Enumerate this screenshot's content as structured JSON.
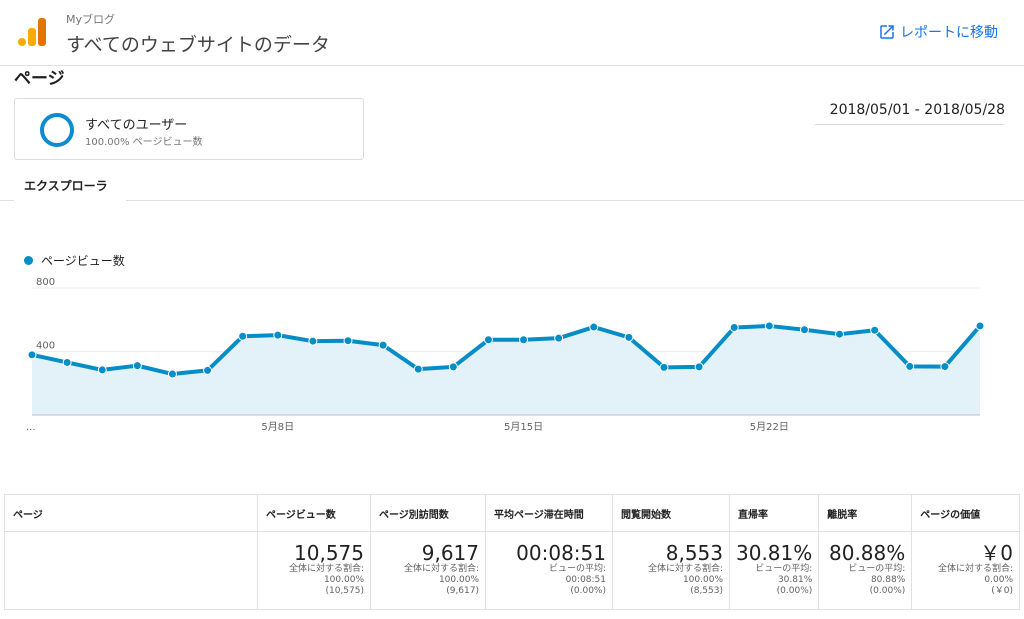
{
  "header": {
    "account": "Myブログ",
    "property": "すべてのウェブサイトのデータ",
    "report_link": "レポートに移動"
  },
  "page_title": "ページ",
  "segment": {
    "name": "すべてのユーザー",
    "sub": "100.00% ページビュー数"
  },
  "date_range": "2018/05/01 - 2018/05/28",
  "tab": "エクスプローラ",
  "legend": "ページビュー数",
  "colors": {
    "line": "#058dc7",
    "fill": "#e3f1f9",
    "link": "#1a73e8"
  },
  "chart_data": {
    "type": "line",
    "series": [
      {
        "name": "ページビュー数",
        "values": [
          379,
          331,
          284,
          311,
          258,
          281,
          496,
          503,
          465,
          468,
          440,
          289,
          303,
          474,
          474,
          484,
          554,
          489,
          300,
          303,
          551,
          561,
          537,
          509,
          534,
          306,
          305,
          561
        ]
      }
    ],
    "yticks": [
      {
        "value": 400,
        "label": "400"
      },
      {
        "value": 800,
        "label": "800"
      }
    ],
    "xticks": [
      {
        "index": 0,
        "label": "..."
      },
      {
        "index": 7,
        "label": "5月8日"
      },
      {
        "index": 14,
        "label": "5月15日"
      },
      {
        "index": 21,
        "label": "5月22日"
      }
    ],
    "ylim": [
      0,
      800
    ]
  },
  "table": {
    "headers": [
      "ページ",
      "ページビュー数",
      "ページ別訪問数",
      "平均ページ滞在時間",
      "閲覧開始数",
      "直帰率",
      "離脱率",
      "ページの価値"
    ],
    "totals": [
      {
        "value": "10,575",
        "lines": [
          "全体に対する割合:",
          "100.00%",
          "(10,575)"
        ]
      },
      {
        "value": "9,617",
        "lines": [
          "全体に対する割合:",
          "100.00%",
          "(9,617)"
        ]
      },
      {
        "value": "00:08:51",
        "lines": [
          "ビューの平均:",
          "00:08:51",
          "(0.00%)"
        ]
      },
      {
        "value": "8,553",
        "lines": [
          "全体に対する割合:",
          "100.00%",
          "(8,553)"
        ]
      },
      {
        "value": "30.81%",
        "lines": [
          "ビューの平均:",
          "30.81%",
          "(0.00%)"
        ]
      },
      {
        "value": "80.88%",
        "lines": [
          "ビューの平均:",
          "80.88%",
          "(0.00%)"
        ]
      },
      {
        "value": "￥0",
        "lines": [
          "全体に対する割合:",
          "0.00%",
          "(￥0)"
        ]
      }
    ]
  }
}
